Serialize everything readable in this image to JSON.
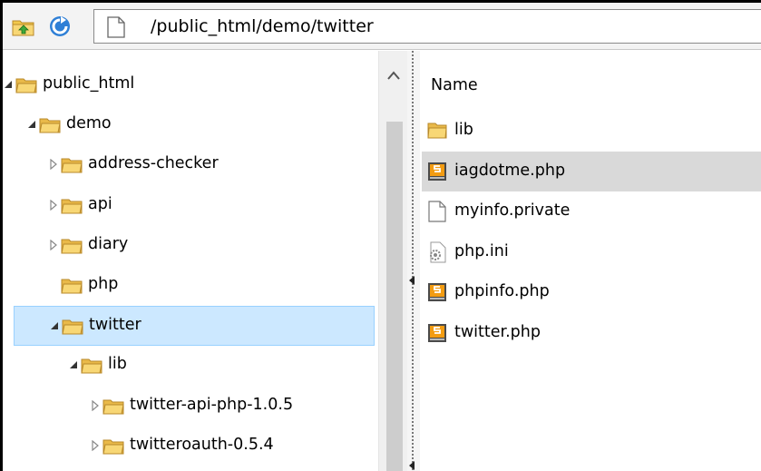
{
  "address_bar": {
    "path": "/public_html/demo/twitter"
  },
  "toolbar": {
    "up_icon": "folder-up-icon",
    "refresh_icon": "refresh-icon"
  },
  "tree": {
    "items": [
      {
        "label": "public_html",
        "depth": 0,
        "expander": "expanded"
      },
      {
        "label": "demo",
        "depth": 1,
        "expander": "expanded"
      },
      {
        "label": "address-checker",
        "depth": 2,
        "expander": "collapsed"
      },
      {
        "label": "api",
        "depth": 2,
        "expander": "collapsed"
      },
      {
        "label": "diary",
        "depth": 2,
        "expander": "collapsed"
      },
      {
        "label": "php",
        "depth": 2,
        "expander": "none"
      },
      {
        "label": "twitter",
        "depth": 2,
        "expander": "expanded",
        "selected": true
      },
      {
        "label": "lib",
        "depth": 3,
        "expander": "expanded"
      },
      {
        "label": "twitter-api-php-1.0.5",
        "depth": 4,
        "expander": "collapsed"
      },
      {
        "label": "twitteroauth-0.5.4",
        "depth": 4,
        "expander": "collapsed"
      }
    ]
  },
  "file_list": {
    "column_header": "Name",
    "items": [
      {
        "label": "lib",
        "icon": "folder-icon"
      },
      {
        "label": "iagdotme.php",
        "icon": "php-file-icon",
        "highlighted": true
      },
      {
        "label": "myinfo.private",
        "icon": "blank-file-icon"
      },
      {
        "label": "php.ini",
        "icon": "settings-file-icon"
      },
      {
        "label": "phpinfo.php",
        "icon": "php-file-icon"
      },
      {
        "label": "twitter.php",
        "icon": "php-file-icon"
      }
    ]
  },
  "colors": {
    "selection_bg": "#cce8ff",
    "selection_border": "#99d1ff",
    "highlight_bg": "#d9d9d9",
    "folder_yellow": "#f8d775"
  }
}
